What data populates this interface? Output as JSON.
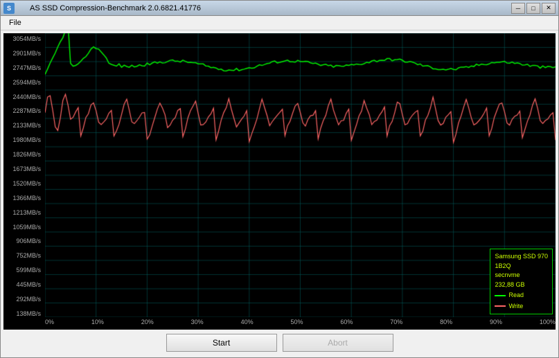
{
  "window": {
    "title": "AS SSD Compression-Benchmark 2.0.6821.41776",
    "icon": "SSD"
  },
  "menu": {
    "file_label": "File"
  },
  "chart": {
    "y_labels": [
      "3054MB/s",
      "2901MB/s",
      "2747MB/s",
      "2594MB/s",
      "2440MB/s",
      "2287MB/s",
      "2133MB/s",
      "1980MB/s",
      "1826MB/s",
      "1673MB/s",
      "1520MB/s",
      "1366MB/s",
      "1213MB/s",
      "1059MB/s",
      "906MB/s",
      "752MB/s",
      "599MB/s",
      "445MB/s",
      "292MB/s",
      "138MB/s"
    ],
    "x_labels": [
      "0%",
      "10%",
      "20%",
      "30%",
      "40%",
      "50%",
      "60%",
      "70%",
      "80%",
      "90%",
      "100%"
    ],
    "legend": {
      "device": "Samsung SSD 970",
      "model": "1B2Q",
      "driver": "secnvme",
      "size": "232,88 GB",
      "read_label": "Read",
      "write_label": "Write"
    }
  },
  "buttons": {
    "start_label": "Start",
    "abort_label": "Abort"
  },
  "title_controls": {
    "minimize": "─",
    "maximize": "□",
    "close": "✕"
  }
}
